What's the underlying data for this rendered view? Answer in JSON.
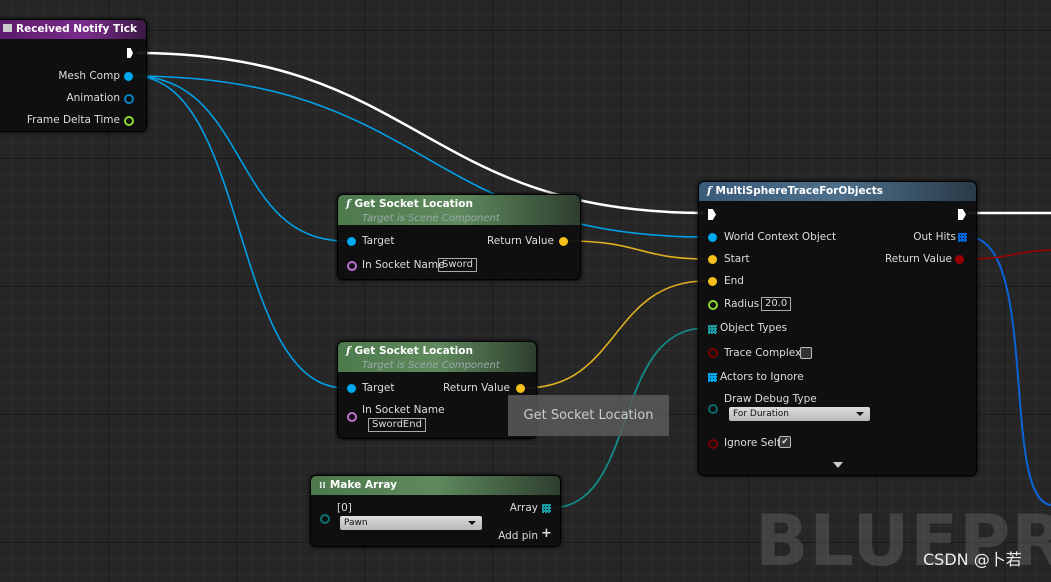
{
  "colors": {
    "exec": "#ffffff",
    "object": "#00a8f0",
    "vector": "#f7c01b",
    "float": "#8cd830",
    "bool": "#8b0000",
    "array_obj": "#1a9aa0",
    "enum": "#006a6a",
    "func_header": "#4a6e4a",
    "event_header": "#6b1e7c",
    "trace_header": "#3c5670"
  },
  "event_node": {
    "title": "Received Notify Tick",
    "icon": "event-icon",
    "pins": [
      "Mesh Comp",
      "Animation",
      "Frame Delta Time"
    ]
  },
  "get_socket_1": {
    "title": "Get Socket Location",
    "subtitle": "Target is Scene Component",
    "target": "Target",
    "return": "Return Value",
    "socket_label": "In Socket Name",
    "socket_value": "Sword"
  },
  "get_socket_2": {
    "title": "Get Socket Location",
    "subtitle": "Target is Scene Component",
    "target": "Target",
    "return": "Return Value",
    "socket_label": "In Socket Name",
    "socket_value": "SwordEnd"
  },
  "make_array": {
    "title": "Make Array",
    "index": "[0]",
    "value": "Pawn",
    "array": "Array",
    "add_pin": "Add pin"
  },
  "trace_node": {
    "title": "MultiSphereTraceForObjects",
    "world": "World Context Object",
    "start": "Start",
    "end": "End",
    "radius": "Radius",
    "radius_value": "20.0",
    "object_types": "Object Types",
    "trace_complex": "Trace Complex",
    "trace_complex_checked": false,
    "actors_ignore": "Actors to Ignore",
    "draw_debug": "Draw Debug Type",
    "draw_debug_value": "For Duration",
    "ignore_self": "Ignore Self",
    "ignore_self_checked": true,
    "out_hits": "Out Hits",
    "return": "Return Value"
  },
  "tooltip": "Get Socket Location",
  "watermark": "BLUEPRINT",
  "credit": "CSDN @卜若"
}
